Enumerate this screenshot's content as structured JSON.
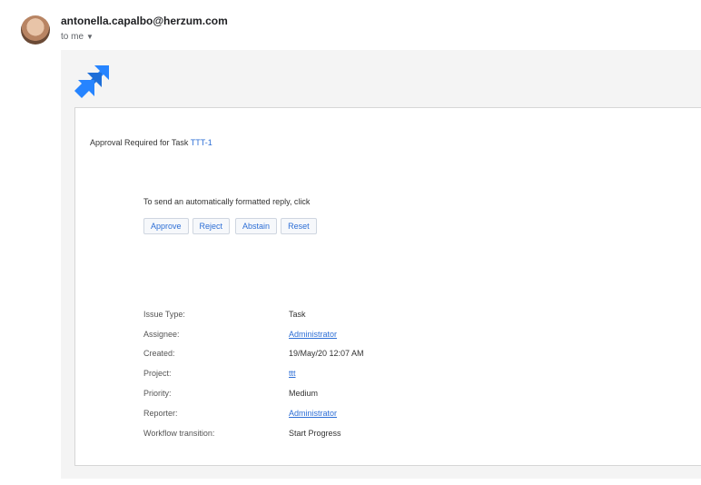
{
  "header": {
    "sender_email": "antonella.capalbo@herzum.com",
    "recipient_label": "to me"
  },
  "brand": {
    "logo_icon": "jira-logo-icon",
    "accent_color": "#2684ff"
  },
  "message": {
    "heading_prefix": "Approval Required for Task",
    "task_key": "TTT-1",
    "reply_instruction": "To send an automatically formatted reply, click",
    "buttons": {
      "approve": "Approve",
      "reject": "Reject",
      "abstain": "Abstain",
      "reset": "Reset"
    }
  },
  "details": [
    {
      "label": "Issue Type:",
      "value": "Task",
      "link": false
    },
    {
      "label": "Assignee:",
      "value": "Administrator",
      "link": true
    },
    {
      "label": "Created:",
      "value": "19/May/20 12:07 AM",
      "link": false
    },
    {
      "label": "Project:",
      "value": "ttt",
      "link": true
    },
    {
      "label": "Priority:",
      "value": "Medium",
      "link": false
    },
    {
      "label": "Reporter:",
      "value": "Administrator",
      "link": true
    },
    {
      "label": "Workflow transition:",
      "value": "Start Progress",
      "link": false
    }
  ]
}
